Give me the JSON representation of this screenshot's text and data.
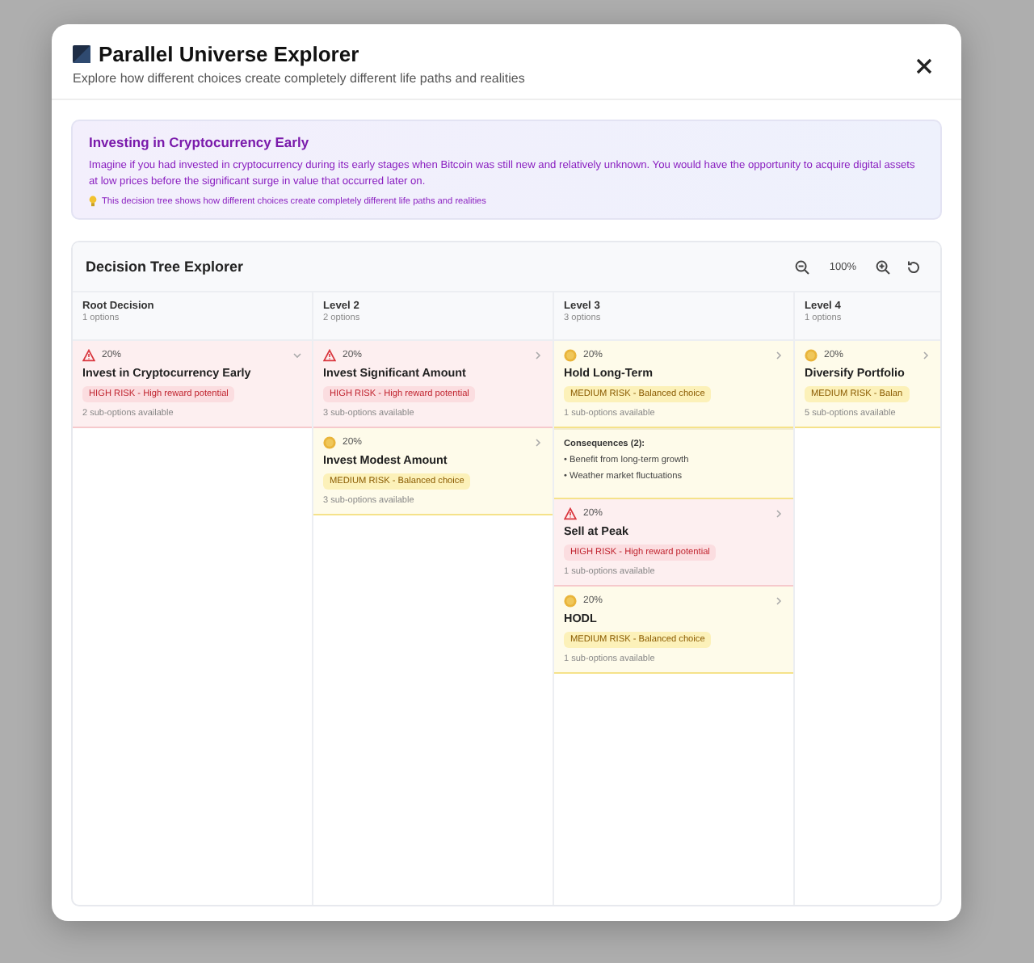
{
  "dialog": {
    "title": "Parallel Universe Explorer",
    "subtitle": "Explore how different choices create completely different life paths and realities"
  },
  "scenario": {
    "title": "Investing in Cryptocurrency Early",
    "description": "Imagine if you had invested in cryptocurrency during its early stages when Bitcoin was still new and relatively unknown. You would have the opportunity to acquire digital assets at low prices before the significant surge in value that occurred later on.",
    "note": "This decision tree shows how different choices create completely different life paths and realities"
  },
  "tree": {
    "title": "Decision Tree Explorer",
    "zoom": "100%",
    "columns": [
      {
        "name": "Root Decision",
        "count": "1 options",
        "cards": [
          {
            "kind": "high",
            "percent": "20%",
            "title": "Invest in Cryptocurrency Early",
            "badge": "HIGH RISK - High reward potential",
            "sub": "2 sub-options available",
            "expanded": true
          }
        ]
      },
      {
        "name": "Level 2",
        "count": "2 options",
        "cards": [
          {
            "kind": "high",
            "percent": "20%",
            "title": "Invest Significant Amount",
            "badge": "HIGH RISK - High reward potential",
            "sub": "3 sub-options available",
            "expanded": false
          },
          {
            "kind": "medium",
            "percent": "20%",
            "title": "Invest Modest Amount",
            "badge": "MEDIUM RISK - Balanced choice",
            "sub": "3 sub-options available",
            "expanded": false
          }
        ]
      },
      {
        "name": "Level 3",
        "count": "3 options",
        "cards": [
          {
            "kind": "medium",
            "percent": "20%",
            "title": "Hold Long-Term",
            "badge": "MEDIUM RISK - Balanced choice",
            "sub": "1 sub-options available",
            "expanded": false,
            "consequences": {
              "title": "Consequences (2):",
              "items": [
                "• Benefit from long-term growth",
                "• Weather market fluctuations"
              ]
            }
          },
          {
            "kind": "high",
            "percent": "20%",
            "title": "Sell at Peak",
            "badge": "HIGH RISK - High reward potential",
            "sub": "1 sub-options available",
            "expanded": false
          },
          {
            "kind": "medium",
            "percent": "20%",
            "title": "HODL",
            "badge": "MEDIUM RISK - Balanced choice",
            "sub": "1 sub-options available",
            "expanded": false
          }
        ]
      },
      {
        "name": "Level 4",
        "count": "1 options",
        "cards": [
          {
            "kind": "medium",
            "percent": "20%",
            "title": "Diversify Portfolio",
            "badge": "MEDIUM RISK - Balan",
            "sub": "5 sub-options available",
            "expanded": false
          }
        ]
      }
    ]
  }
}
